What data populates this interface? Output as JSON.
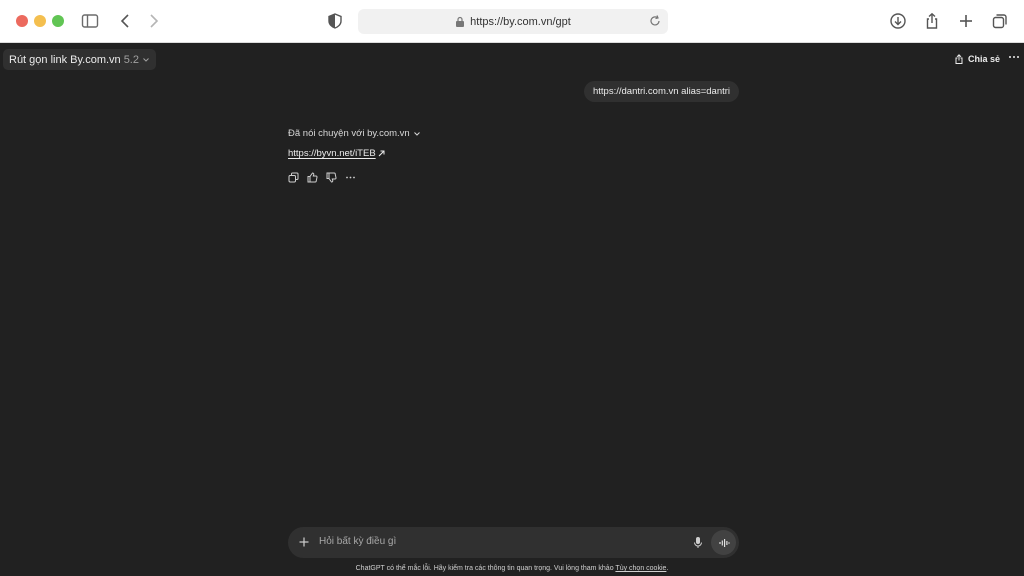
{
  "browser": {
    "url": "https://by.com.vn/gpt",
    "icons": [
      "sidebar-icon",
      "back-icon",
      "forward-icon",
      "shield-icon",
      "lock-icon",
      "reload-icon",
      "download-icon",
      "share-icon",
      "new-tab-icon",
      "tabs-overview-icon"
    ]
  },
  "header": {
    "model_name": "Rút gọn link By.com.vn",
    "model_version": "5.2",
    "share_label": "Chia sẻ"
  },
  "conversation": {
    "user_message": "https://dantri.com.vn alias=dantri",
    "tool_status": "Đã nói chuyện với by.com.vn",
    "result_link": "https://byvn.net/iTEB",
    "actions": [
      "copy-icon",
      "thumbs-up-icon",
      "thumbs-down-icon",
      "more-icon"
    ]
  },
  "composer": {
    "placeholder": "Hỏi bất kỳ điều gì"
  },
  "footer": {
    "disclaimer": "ChatGPT có thể mắc lỗi. Hãy kiểm tra các thông tin quan trọng. Vui lòng tham khảo",
    "cookie_link": "Tùy chọn cookie",
    "end": "."
  },
  "colors": {
    "background": "#212121",
    "bubble": "#303030",
    "text": "#ececec"
  }
}
